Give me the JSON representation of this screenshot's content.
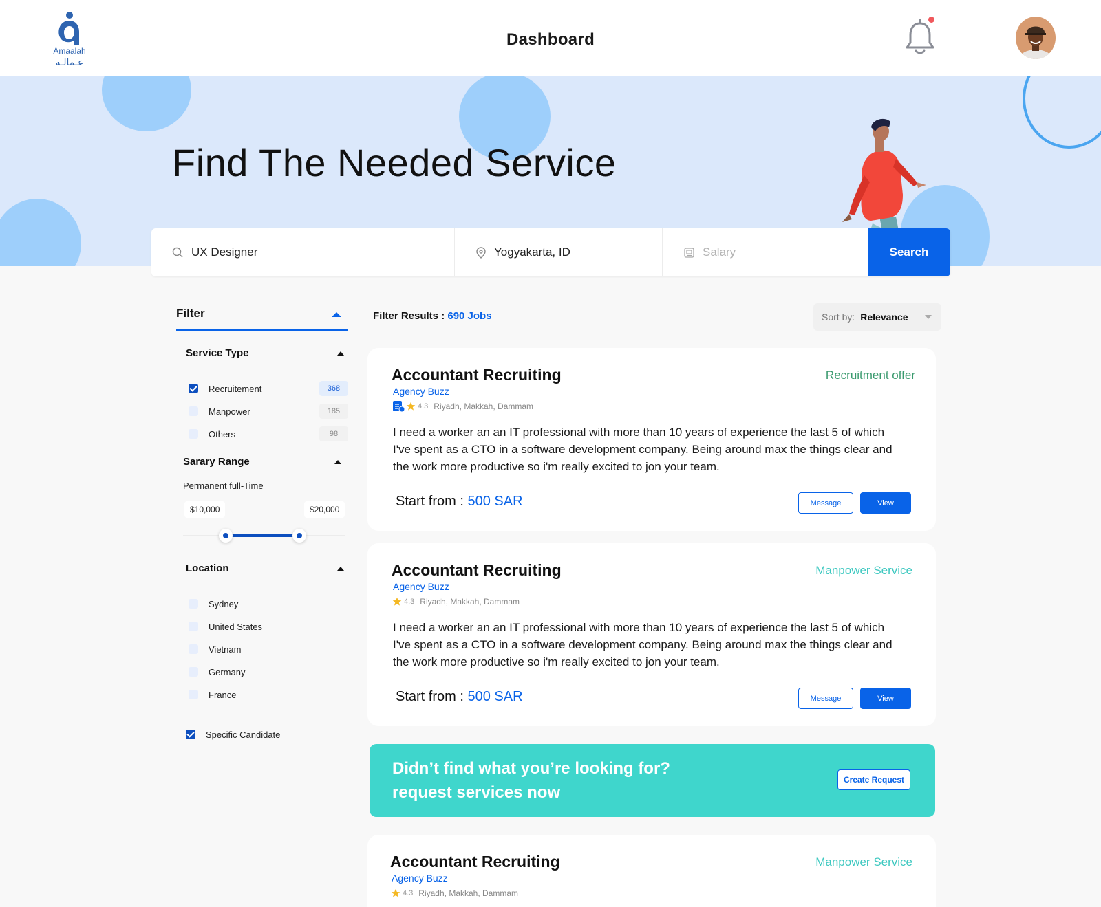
{
  "header": {
    "logo_text": "Amaalah",
    "logo_text_ar": "عـمالـة",
    "title": "Dashboard"
  },
  "hero": {
    "title": "Find The Needed Service"
  },
  "search": {
    "keyword_value": "UX Designer",
    "location_value": "Yogyakarta, ID",
    "salary_placeholder": "Salary",
    "button_label": "Search"
  },
  "filter": {
    "title": "Filter",
    "service_type": {
      "title": "Service Type",
      "options": [
        {
          "label": "Recruitement",
          "count": "368",
          "checked": true
        },
        {
          "label": "Manpower",
          "count": "185",
          "checked": false
        },
        {
          "label": "Others",
          "count": "98",
          "checked": false
        }
      ]
    },
    "salary_range": {
      "title": "Sarary Range",
      "subtitle": "Permanent full-Time",
      "min_label": "$10,000",
      "max_label": "$20,000"
    },
    "location": {
      "title": "Location",
      "options": [
        {
          "label": "Sydney",
          "checked": false
        },
        {
          "label": "United States",
          "checked": false
        },
        {
          "label": "Vietnam",
          "checked": false
        },
        {
          "label": "Germany",
          "checked": false
        },
        {
          "label": "France",
          "checked": false
        }
      ]
    },
    "specific_candidate": {
      "label": "Specific Candidate",
      "checked": true
    }
  },
  "results": {
    "label": "Filter Results :",
    "count": "690 Jobs",
    "sort_label": "Sort by:",
    "sort_value": "Relevance"
  },
  "jobs": [
    {
      "title": "Accountant Recruiting",
      "type": "Recruitment offer",
      "agency": "Agency Buzz",
      "rating": "4.3",
      "locations": "Riyadh, Makkah, Dammam",
      "description": "I need a worker an an IT professional with more than 10 years of experience the last 5 of which I've spent as a CTO in a software development company. Being around max the things clear and the work more productive so i'm really excited to jon your team.",
      "price_label": "Start from :",
      "price_value": "500 SAR",
      "message_label": "Message",
      "view_label": "View"
    },
    {
      "title": "Accountant Recruiting",
      "type": "Manpower Service",
      "agency": "Agency Buzz",
      "rating": "4.3",
      "locations": "Riyadh, Makkah, Dammam",
      "description": "I need a worker an an IT professional with more than 10 years of experience the last 5 of which I've spent as a CTO in a software development company. Being around max the things clear and the work more productive so i'm really excited to jon your team.",
      "price_label": "Start from :",
      "price_value": "500 SAR",
      "message_label": "Message",
      "view_label": "View"
    },
    {
      "title": "Accountant Recruiting",
      "type": "Manpower Service",
      "agency": "Agency Buzz",
      "rating": "4.3",
      "locations": "Riyadh, Makkah, Dammam"
    }
  ],
  "cta": {
    "line1": "Didn’t find what you’re looking for?",
    "line2": "request services now",
    "button_label": "Create Request"
  },
  "colors": {
    "primary": "#0963e8",
    "recruitment_type": "#3a9a6e",
    "manpower_type": "#3dc8c0",
    "cta_bg": "#3fd6cc",
    "hero_bg": "#dbe8fb"
  },
  "icons": [
    "logo-icon",
    "bell-icon",
    "search-icon",
    "location-pin-icon",
    "salary-icon",
    "verified-icon",
    "star-icon"
  ]
}
